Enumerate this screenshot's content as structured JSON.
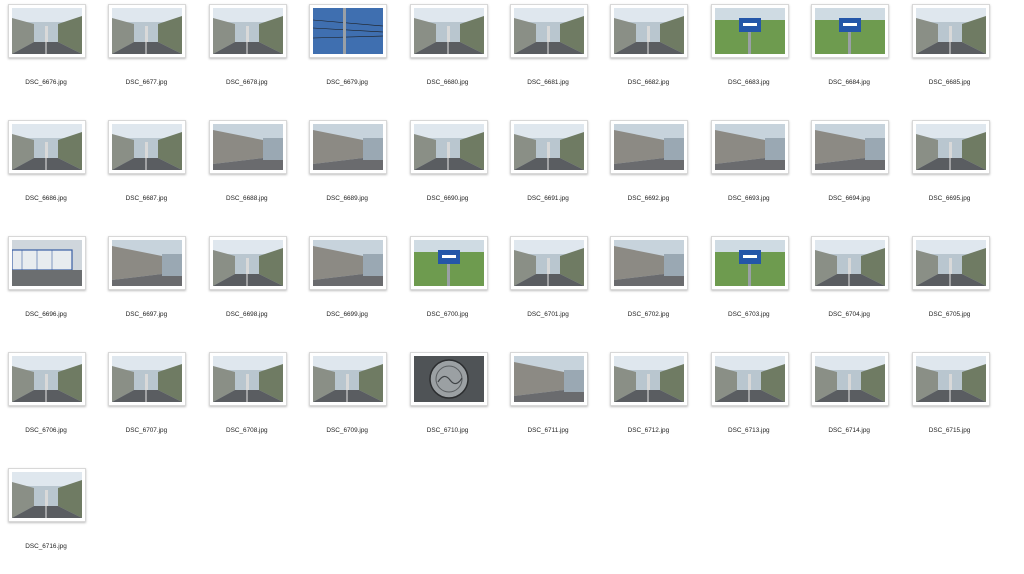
{
  "files": [
    {
      "name": "DSC_6676.jpg",
      "icon": "photo-street"
    },
    {
      "name": "DSC_6677.jpg",
      "icon": "photo-street"
    },
    {
      "name": "DSC_6678.jpg",
      "icon": "photo-street"
    },
    {
      "name": "DSC_6679.jpg",
      "icon": "photo-sky-wires"
    },
    {
      "name": "DSC_6680.jpg",
      "icon": "photo-street"
    },
    {
      "name": "DSC_6681.jpg",
      "icon": "photo-street"
    },
    {
      "name": "DSC_6682.jpg",
      "icon": "photo-street"
    },
    {
      "name": "DSC_6683.jpg",
      "icon": "photo-sign"
    },
    {
      "name": "DSC_6684.jpg",
      "icon": "photo-sign"
    },
    {
      "name": "DSC_6685.jpg",
      "icon": "photo-street"
    },
    {
      "name": "DSC_6686.jpg",
      "icon": "photo-street"
    },
    {
      "name": "DSC_6687.jpg",
      "icon": "photo-street"
    },
    {
      "name": "DSC_6688.jpg",
      "icon": "photo-wall"
    },
    {
      "name": "DSC_6689.jpg",
      "icon": "photo-wall"
    },
    {
      "name": "DSC_6690.jpg",
      "icon": "photo-street"
    },
    {
      "name": "DSC_6691.jpg",
      "icon": "photo-street"
    },
    {
      "name": "DSC_6692.jpg",
      "icon": "photo-wall"
    },
    {
      "name": "DSC_6693.jpg",
      "icon": "photo-wall"
    },
    {
      "name": "DSC_6694.jpg",
      "icon": "photo-wall"
    },
    {
      "name": "DSC_6695.jpg",
      "icon": "photo-street"
    },
    {
      "name": "DSC_6696.jpg",
      "icon": "photo-fence"
    },
    {
      "name": "DSC_6697.jpg",
      "icon": "photo-wall"
    },
    {
      "name": "DSC_6698.jpg",
      "icon": "photo-street"
    },
    {
      "name": "DSC_6699.jpg",
      "icon": "photo-wall"
    },
    {
      "name": "DSC_6700.jpg",
      "icon": "photo-sign"
    },
    {
      "name": "DSC_6701.jpg",
      "icon": "photo-street"
    },
    {
      "name": "DSC_6702.jpg",
      "icon": "photo-wall"
    },
    {
      "name": "DSC_6703.jpg",
      "icon": "photo-sign"
    },
    {
      "name": "DSC_6704.jpg",
      "icon": "photo-street"
    },
    {
      "name": "DSC_6705.jpg",
      "icon": "photo-street"
    },
    {
      "name": "DSC_6706.jpg",
      "icon": "photo-street"
    },
    {
      "name": "DSC_6707.jpg",
      "icon": "photo-street"
    },
    {
      "name": "DSC_6708.jpg",
      "icon": "photo-street"
    },
    {
      "name": "DSC_6709.jpg",
      "icon": "photo-street"
    },
    {
      "name": "DSC_6710.jpg",
      "icon": "photo-manhole"
    },
    {
      "name": "DSC_6711.jpg",
      "icon": "photo-wall"
    },
    {
      "name": "DSC_6712.jpg",
      "icon": "photo-street"
    },
    {
      "name": "DSC_6713.jpg",
      "icon": "photo-street"
    },
    {
      "name": "DSC_6714.jpg",
      "icon": "photo-street"
    },
    {
      "name": "DSC_6715.jpg",
      "icon": "photo-street"
    },
    {
      "name": "DSC_6716.jpg",
      "icon": "photo-street"
    }
  ]
}
